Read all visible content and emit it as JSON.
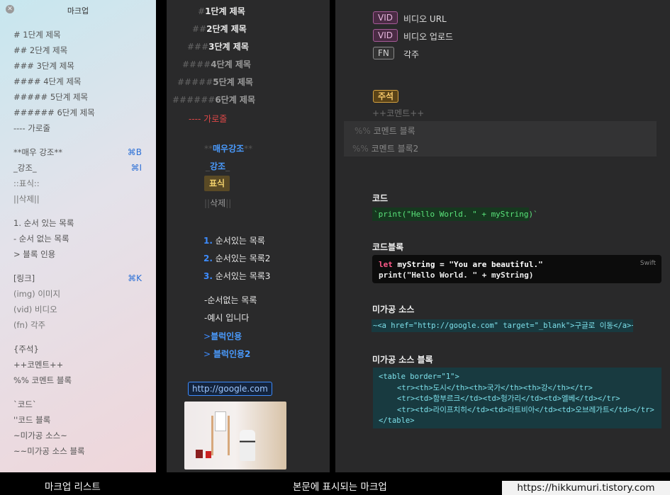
{
  "sidebar": {
    "title": "마크업",
    "items": [
      {
        "text": "# 1단계 제목",
        "shortcut": ""
      },
      {
        "text": "## 2단계 제목",
        "shortcut": ""
      },
      {
        "text": "### 3단계 제목",
        "shortcut": ""
      },
      {
        "text": "#### 4단계 제목",
        "shortcut": ""
      },
      {
        "text": "##### 5단계 제목",
        "shortcut": ""
      },
      {
        "text": "###### 6단계 제목",
        "shortcut": ""
      },
      {
        "text": "---- 가로줄",
        "shortcut": ""
      },
      {
        "text": "**매우 강조**",
        "shortcut": "⌘B"
      },
      {
        "text": "_강조_",
        "shortcut": "⌘I"
      },
      {
        "text": "::표식::",
        "shortcut": ""
      },
      {
        "text": "||삭제||",
        "shortcut": ""
      },
      {
        "text": "1. 순서 있는 목록",
        "shortcut": ""
      },
      {
        "text": "- 순서 없는 목록",
        "shortcut": ""
      },
      {
        "text": "> 블록 인용",
        "shortcut": ""
      },
      {
        "text": "[링크]",
        "shortcut": "⌘K"
      },
      {
        "text": "(img) 이미지",
        "shortcut": ""
      },
      {
        "text": "(vid) 비디오",
        "shortcut": ""
      },
      {
        "text": "(fn) 각주",
        "shortcut": ""
      },
      {
        "text": "{주석}",
        "shortcut": ""
      },
      {
        "text": "++코멘트++",
        "shortcut": ""
      },
      {
        "text": "%% 코멘트 블록",
        "shortcut": ""
      },
      {
        "text": "`코드`",
        "shortcut": ""
      },
      {
        "text": "''코드 블록",
        "shortcut": ""
      },
      {
        "text": "~미가공 소스~",
        "shortcut": ""
      },
      {
        "text": "~~미가공 소스 블록",
        "shortcut": ""
      }
    ]
  },
  "preview": {
    "headings": [
      {
        "hash": "#",
        "text": "1단계 제목"
      },
      {
        "hash": "##",
        "text": "2단계 제목"
      },
      {
        "hash": "###",
        "text": "3단계 제목"
      },
      {
        "hash": "####",
        "text": "4단계 제목"
      },
      {
        "hash": "#####",
        "text": "5단계 제목"
      },
      {
        "hash": "######",
        "text": "6단계 제목"
      }
    ],
    "hr": {
      "dash": "----",
      "text": "가로줄"
    },
    "strong": "매우강조",
    "em": "강조",
    "mark": "표식",
    "del": "삭제",
    "ordered": [
      {
        "num": "1.",
        "text": "순서있는 목록"
      },
      {
        "num": "2.",
        "text": "순서있는 목록2"
      },
      {
        "num": "3.",
        "text": "순서있는 목록3"
      }
    ],
    "unordered": [
      "-순서없는 목록",
      "-예시 입니다"
    ],
    "quotes": [
      "블럭인용",
      "블럭인용2"
    ],
    "link": "http://google.com"
  },
  "editor": {
    "tags": [
      {
        "tag": "VID",
        "text": "비디오 URL"
      },
      {
        "tag": "VID",
        "text": "비디오 업로드"
      },
      {
        "tag": "FN",
        "text": "각주"
      }
    ],
    "note_tag": "주석",
    "comment_inline": "++코멘트++",
    "comment_blocks": [
      {
        "pct": "%%",
        "text": "코멘트 블록"
      },
      {
        "pct": "%%",
        "text": "코멘트 블록2"
      }
    ],
    "code_label": "코드",
    "code_inline": "`print(\"Hello World. \" + myString)`",
    "codeblock_label": "코드블록",
    "codeblock": {
      "lang": "Swift",
      "line1_kw": "let",
      "line1_rest": " myString = \"You are beautiful.\"",
      "line2": "print(\"Hello World. \" + myString)"
    },
    "raw_label": "미가공 소스",
    "raw_inline": "~<a href=\"http://google.com\" target=\"_blank\">구글로 이동</a>~",
    "rawblock_label": "미가공 소스 블록",
    "rawblock": [
      "<table border=\"1\">",
      "<tr><th>도시</th><th>국가</th><th>강</th></tr>",
      "<tr><td>함부르크</td><td>헝가리</td><td>엘베</td></tr>",
      "<tr><td>라이프치히</td><td>라트비아</td><td>오브레가트</td></tr>",
      "</table>"
    ]
  },
  "captions": {
    "left": "마크업 리스트",
    "center": "본문에 표시되는 마크업",
    "url": "https://hikkumuri.tistory.com"
  }
}
